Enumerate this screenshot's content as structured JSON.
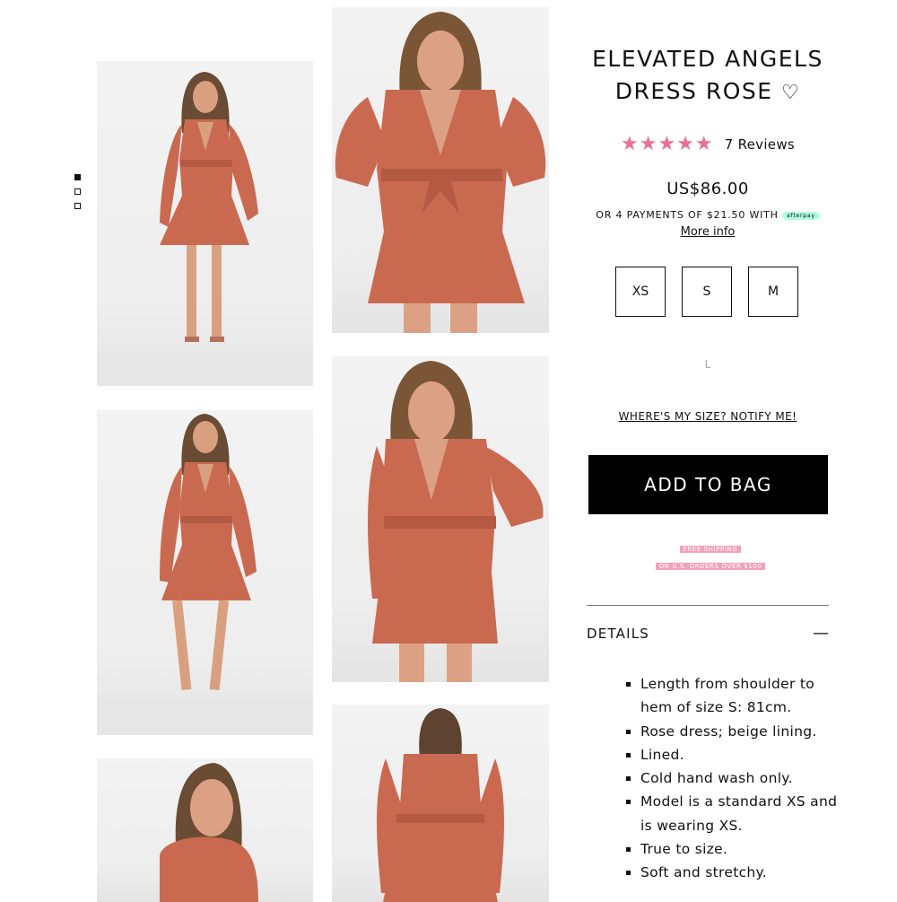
{
  "product": {
    "title_line1": "ELEVATED ANGELS",
    "title_line2": "DRESS ROSE",
    "heart_icon": "heart-outline-icon",
    "rating_stars": 5,
    "reviews": "7 Reviews",
    "price": "US$86.00",
    "afterpay_text": "OR 4 PAYMENTS OF $21.50 WITH",
    "afterpay_badge": "afterpay",
    "more_info": "More info"
  },
  "sizes": [
    "XS",
    "S",
    "M"
  ],
  "size_faded": "L",
  "notify_link": "WHERE'S MY SIZE? NOTIFY ME!",
  "add_to_bag": "ADD TO BAG",
  "shipping": {
    "line1": "FREE SHIPPING",
    "line2": "ON U.S. ORDERS OVER $100"
  },
  "details": {
    "label": "DETAILS",
    "bullets": [
      "Length from shoulder to hem of size S: 81cm.",
      "Rose dress; beige lining.",
      "Lined.",
      "Cold hand wash only.",
      "Model is a standard XS and is wearing XS.",
      "True to size.",
      "Soft and stretchy."
    ]
  },
  "gallery": {
    "image_count": 3,
    "active_index": 0
  },
  "colors": {
    "star": "#e8709d",
    "dress": "#c96a50",
    "button": "#000000",
    "shipping_pink": "#f2a0bd"
  }
}
